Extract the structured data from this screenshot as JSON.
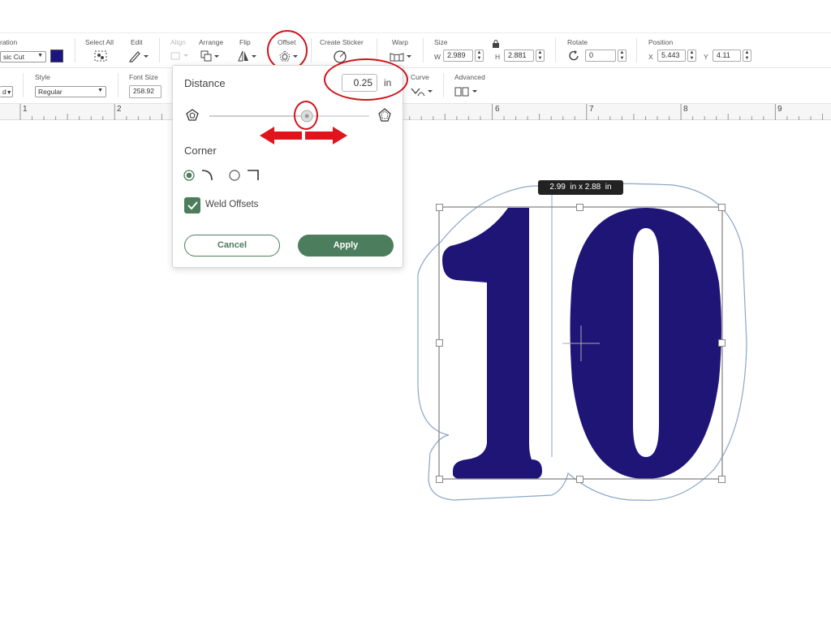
{
  "toolbar_top": {
    "operation_label": "ration",
    "operation_value": "sic Cut",
    "operation_color": "#1b1580",
    "select_all_label": "Select All",
    "edit_label": "Edit",
    "align_label": "Align",
    "arrange_label": "Arrange",
    "flip_label": "Flip",
    "offset_label": "Offset",
    "create_sticker_label": "Create Sticker",
    "warp_label": "Warp",
    "size_label": "Size",
    "width_prefix": "W",
    "width_value": "2.989",
    "height_prefix": "H",
    "height_value": "2.881",
    "rotate_label": "Rotate",
    "rotate_value": "0",
    "position_label": "Position",
    "x_prefix": "X",
    "x_value": "5.443",
    "y_prefix": "Y",
    "y_value": "4.11"
  },
  "toolbar_second": {
    "font_partial": "d",
    "style_label": "Style",
    "style_value": "Regular",
    "font_size_label": "Font Size",
    "font_size_value": "258.92",
    "curve_label": "Curve",
    "advanced_label": "Advanced"
  },
  "ruler": {
    "numbers": [
      "1",
      "2",
      "6",
      "7",
      "8",
      "9"
    ]
  },
  "offset_popup": {
    "distance_label": "Distance",
    "distance_value": "0.25",
    "distance_unit": "in",
    "slider_fraction": 0.61,
    "corner_label": "Corner",
    "corner_options": [
      "rounded",
      "square"
    ],
    "corner_selected": "rounded",
    "weld_label": "Weld Offsets",
    "weld_checked": true,
    "cancel_label": "Cancel",
    "apply_label": "Apply"
  },
  "canvas": {
    "size_tag": "2.99  in x 2.88  in",
    "design_text": "10",
    "design_color": "#1e1577",
    "offset_outline_color": "#8aa6c6"
  },
  "annotations": {
    "marker_color": "#d0141a"
  }
}
